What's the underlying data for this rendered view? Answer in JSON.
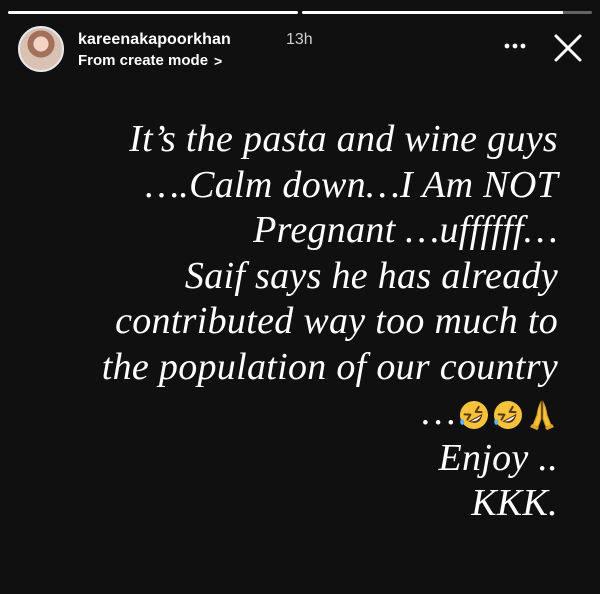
{
  "story": {
    "progress_segments": [
      {
        "filled": 1.0
      },
      {
        "filled": 0.9
      }
    ],
    "username": "kareenakapoorkhan",
    "time_ago": "13h",
    "mode": "From create mode",
    "mode_chevron": ">",
    "text_lines": [
      "It’s the pasta and wine guys",
      "….Calm down…I Am NOT",
      "Pregnant …uffffff…",
      "Saif says he has already",
      "contributed way too much to",
      "the population of our country",
      "…",
      "Enjoy ..",
      "KKK."
    ],
    "emojis": [
      "rolling-on-floor-laughing-icon",
      "rolling-on-floor-laughing-icon",
      "folded-hands-icon"
    ],
    "colors": {
      "background": "#101010",
      "text": "#ffffff",
      "emoji_face": "#f5c33b"
    }
  }
}
